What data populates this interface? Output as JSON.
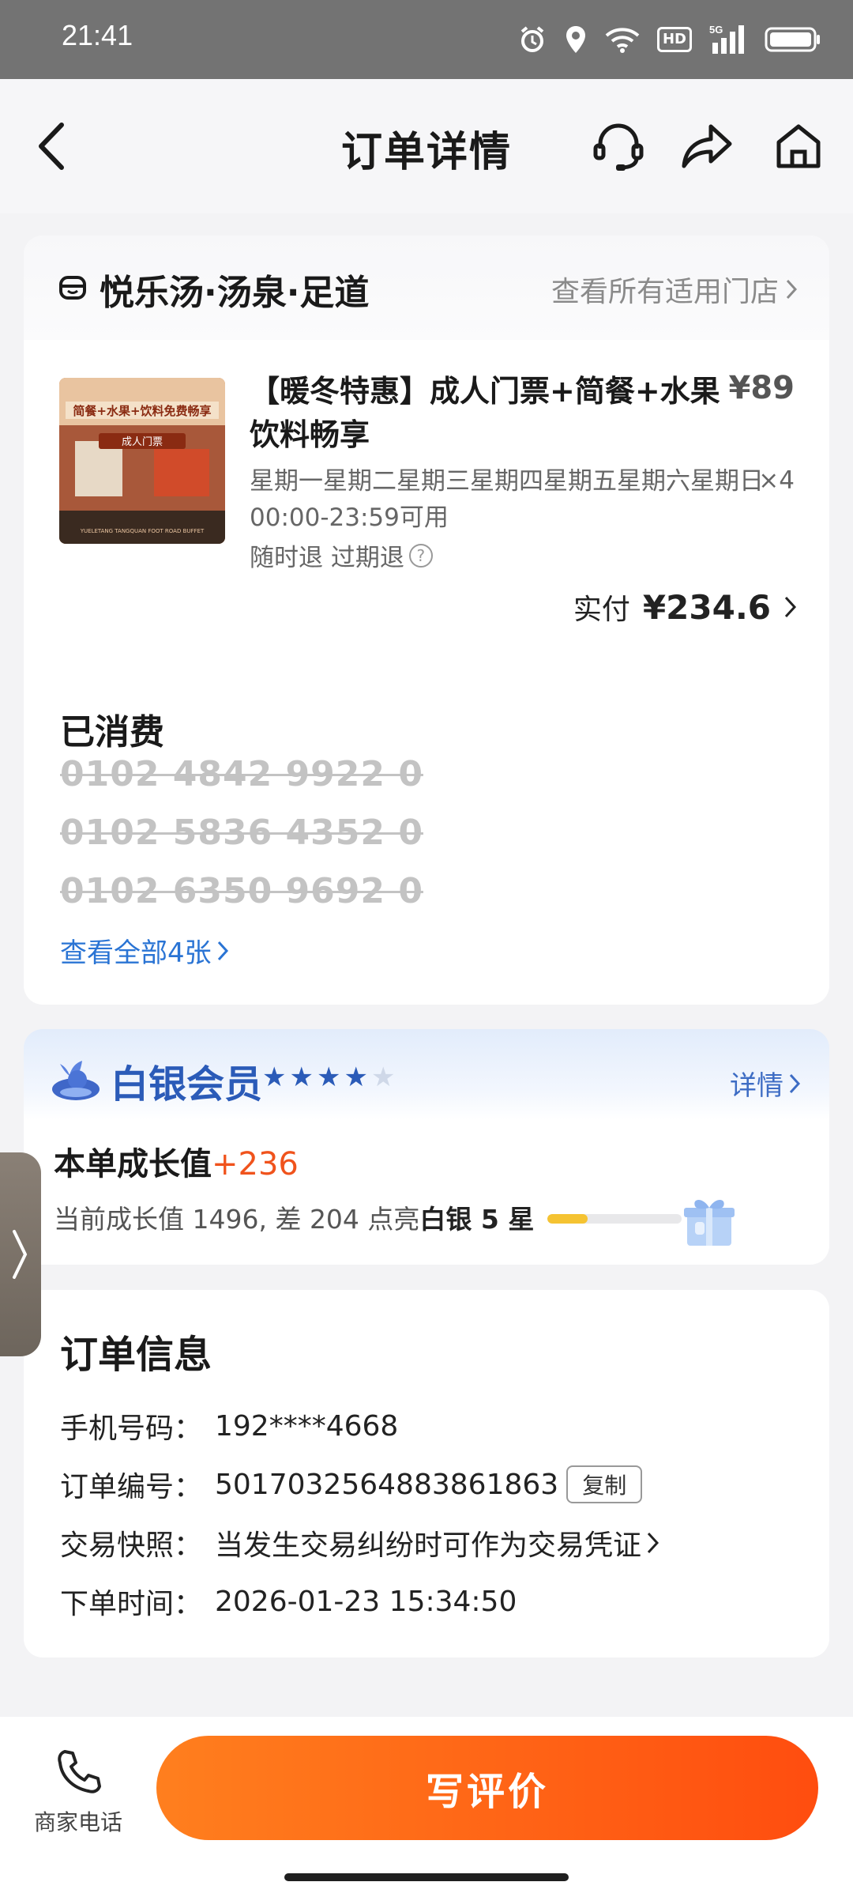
{
  "status_bar": {
    "time": "21:41",
    "network": "5G",
    "hd": "HD"
  },
  "nav": {
    "title": "订单详情"
  },
  "shop": {
    "name": "悦乐汤·汤泉·足道",
    "all_stores_link": "查看所有适用门店"
  },
  "product": {
    "image_banner": "简餐+水果+饮料免费畅享",
    "image_tag": "成人门票",
    "image_footer": "YUELETANG TANGQUAN FOOT ROAD BUFFET",
    "title": "【暖冬特惠】成人门票+简餐+水果饮料畅享",
    "price": "¥89",
    "valid_days": "星期一星期二星期三星期四星期五星期六星期日00:00-23:59可用",
    "quantity": "×4",
    "refund_policy": "随时退 过期退",
    "paid_label": "实付",
    "paid_amount": "¥234.6"
  },
  "consumed": {
    "title": "已消费",
    "codes": [
      "0102 4842 9922 0",
      "0102 5836 4352 0",
      "0102 6350 9692 0"
    ],
    "view_all": "查看全部4张"
  },
  "member": {
    "title": "白银会员",
    "stars_filled": 4,
    "stars_total": 5,
    "detail_link": "详情",
    "growth_label": "本单成长值",
    "growth_value": "+236",
    "growth_desc_prefix": "当前成长值 1496, 差 204 点亮",
    "growth_desc_target": "白银 5 星",
    "progress_fraction": 0.3
  },
  "order_info": {
    "title": "订单信息",
    "rows": [
      {
        "label": "手机号码：",
        "value": "192****4668"
      },
      {
        "label": "订单编号：",
        "value": "5017032564883861863",
        "action": "复制"
      },
      {
        "label": "交易快照：",
        "value": "当发生交易纠纷时可作为交易凭证"
      },
      {
        "label": "下单时间：",
        "value": "2026-01-23 15:34:50"
      }
    ]
  },
  "bottom": {
    "phone_label": "商家电话",
    "review_button": "写评价"
  },
  "colors": {
    "accent": "#ff5a14",
    "link": "#2a74d4",
    "member_blue": "#2b5bb8",
    "growth_orange": "#f0531c"
  },
  "icons": [
    "back-icon",
    "customer-service-icon",
    "share-icon",
    "home-icon",
    "shop-icon",
    "chevron-right-icon",
    "help-icon",
    "member-badge-icon",
    "star-icon",
    "gift-icon",
    "phone-icon",
    "side-expand-icon"
  ]
}
